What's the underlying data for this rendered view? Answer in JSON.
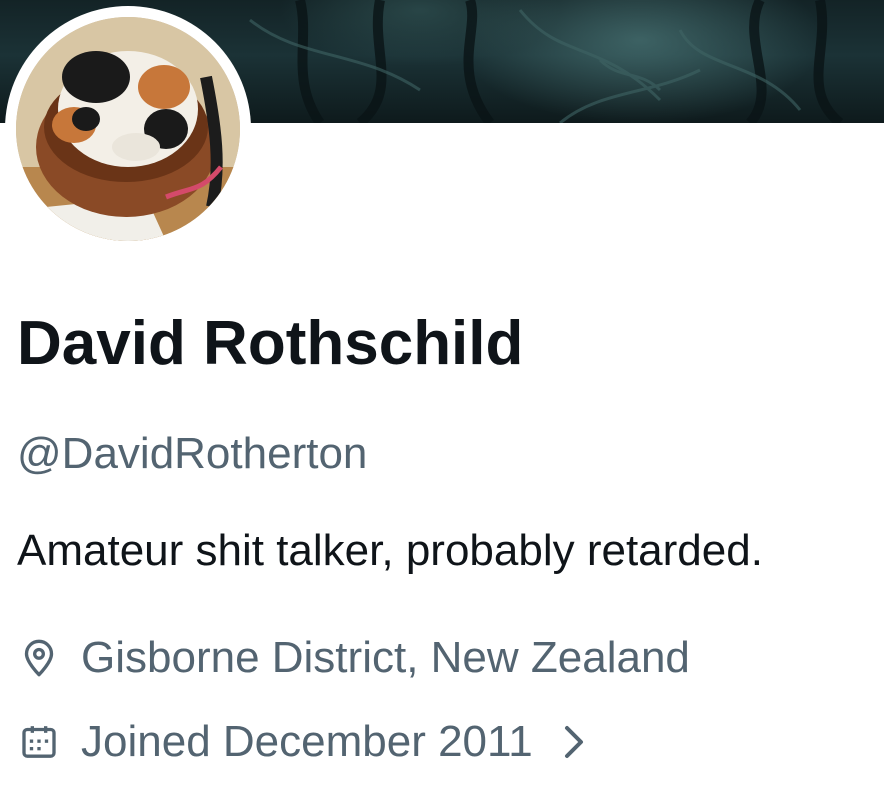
{
  "profile": {
    "display_name": "David Rothschild",
    "handle": "@DavidRotherton",
    "bio": "Amateur shit talker, probably retarded.",
    "location": "Gisborne District, New Zealand",
    "joined": "Joined December 2011"
  },
  "icons": {
    "location": "map-pin-icon",
    "joined": "calendar-icon",
    "more": "chevron-right-icon"
  },
  "colors": {
    "primary_text": "#0f1419",
    "secondary_text": "#536471",
    "background": "#ffffff"
  }
}
